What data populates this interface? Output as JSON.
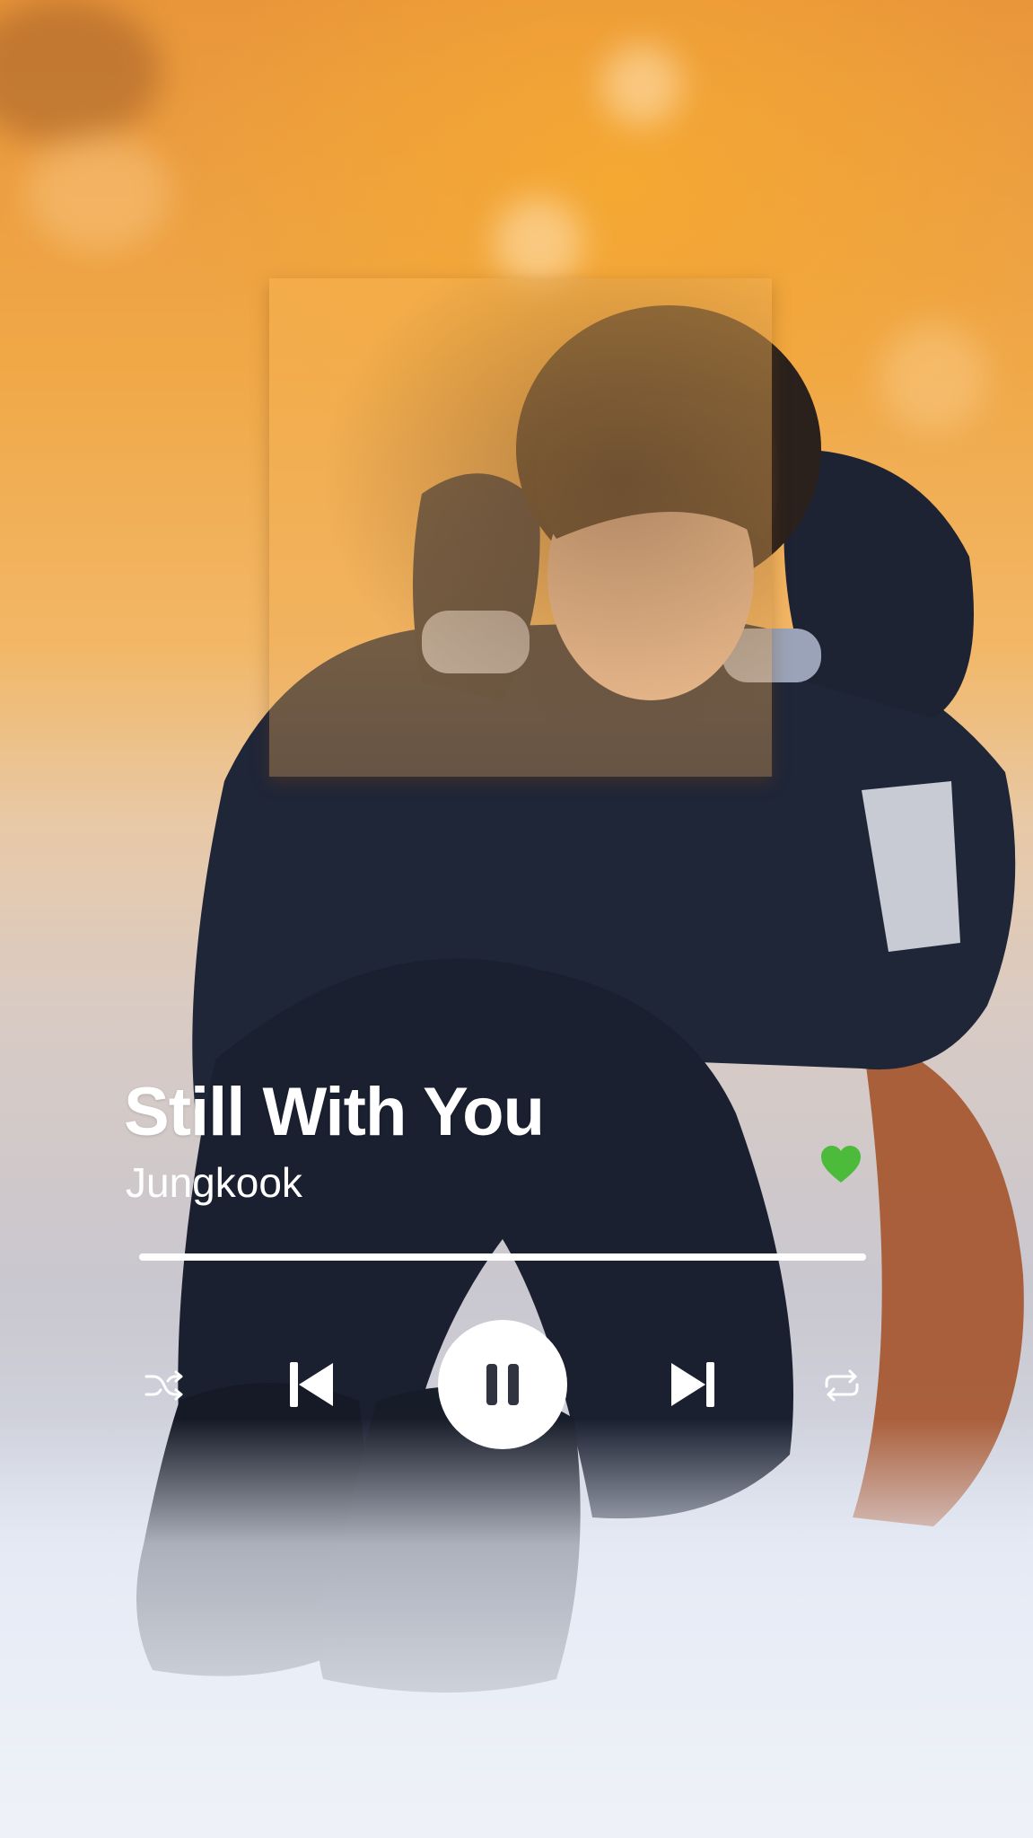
{
  "track": {
    "title": "Still With You",
    "artist": "Jungkook",
    "liked": true,
    "progress": 1.0
  },
  "icons": {
    "like": "heart-icon",
    "shuffle": "shuffle-icon",
    "previous": "skip-previous-icon",
    "play_state": "pause-icon",
    "next": "skip-next-icon",
    "repeat": "repeat-icon"
  },
  "colors": {
    "like": "#4cbb3c",
    "foreground": "#ffffff",
    "pause_glyph": "#2f3440"
  }
}
